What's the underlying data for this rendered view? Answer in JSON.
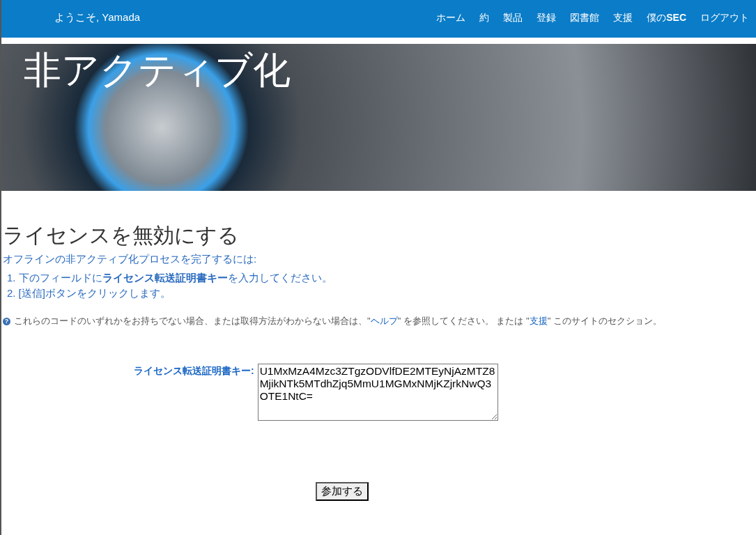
{
  "header": {
    "welcome": "ようこそ, Yamada",
    "nav": [
      {
        "label": "ホーム"
      },
      {
        "label": "約"
      },
      {
        "label": "製品"
      },
      {
        "label": "登録"
      },
      {
        "label": "図書館"
      },
      {
        "label": "支援"
      },
      {
        "label": "僕の**SEC**"
      },
      {
        "label": "ログアウト"
      }
    ]
  },
  "hero": {
    "title": "非アクティブ化"
  },
  "page": {
    "heading": "ライセンスを無効にする",
    "intro": "オフラインの非アクティブ化プロセスを完了するには:",
    "steps": [
      {
        "marker": "1.",
        "text": "下のフィールドに**ライセンス転送証明書キー**を入力してください。"
      },
      {
        "marker": "2.",
        "text": "[送信]ボタンをクリックします。"
      }
    ],
    "help": {
      "icon": "?",
      "before": "これらのコードのいずれかをお持ちでない場合、または取得方法がわからない場合は、\"",
      "link1": "ヘルプ",
      "middle": "\" を参照してください。 または \"",
      "link2": "支援",
      "after": "\" このサイトのセクション。"
    }
  },
  "form": {
    "label": "ライセンス転送証明書キー:",
    "value": "U1MxMzA4Mzc3ZTgzODVlfDE2MTEyNjAzMTZ8MjikNTk5MTdhZjq5MmU1MGMxNMjKZjrkNwQ3OTE1NtC=",
    "button": "参加する"
  }
}
